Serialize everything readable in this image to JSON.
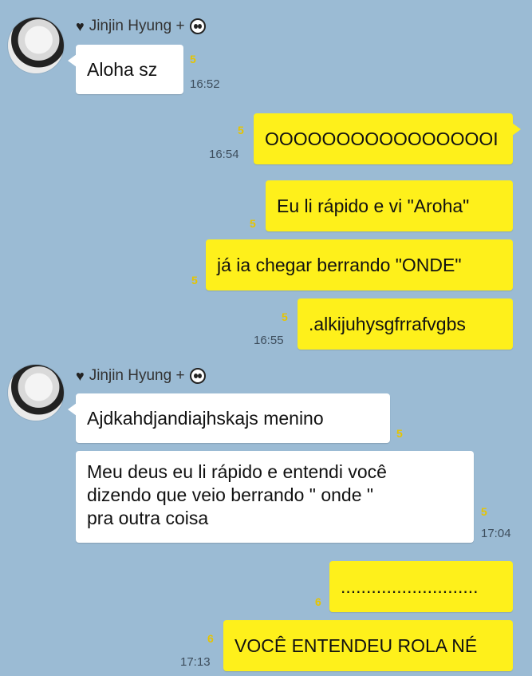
{
  "sender": {
    "name": "Jinjin Hyung +"
  },
  "messages": [
    {
      "id": "m1",
      "dir": "in",
      "text": "Aloha sz",
      "count": "5",
      "time": "16:52"
    },
    {
      "id": "m2",
      "dir": "out",
      "text": "OOOOOOOOOOOOOOOOI",
      "count": "5",
      "time": "16:54"
    },
    {
      "id": "m3",
      "dir": "out",
      "text": "Eu li rápido e vi \"Aroha\"",
      "count": "5",
      "time": ""
    },
    {
      "id": "m4",
      "dir": "out",
      "text": "já ia chegar berrando \"ONDE\"",
      "count": "5",
      "time": ""
    },
    {
      "id": "m5",
      "dir": "out",
      "text": ".alkijuhysgfrrafvgbs",
      "count": "5",
      "time": "16:55"
    },
    {
      "id": "m6",
      "dir": "in",
      "text": "Ajdkahdjandiajhskajs menino",
      "count": "5",
      "time": ""
    },
    {
      "id": "m7",
      "dir": "in",
      "lines": [
        "Meu deus eu li rápido e entendi você",
        "dizendo que veio berrando \" onde \"",
        "pra outra coisa"
      ],
      "count": "5",
      "time": "17:04"
    },
    {
      "id": "m8",
      "dir": "out",
      "text": "...........................",
      "count": "6",
      "time": ""
    },
    {
      "id": "m9",
      "dir": "out",
      "text": "VOCÊ ENTENDEU ROLA NÉ",
      "count": "6",
      "time": "17:13"
    }
  ],
  "colors": {
    "background": "#9bbbd4",
    "outgoing": "#fef01b",
    "incoming": "#ffffff",
    "unread": "#e6c400"
  },
  "icons": {
    "heart": "heart-icon",
    "panda": "panda-emoji-icon"
  }
}
